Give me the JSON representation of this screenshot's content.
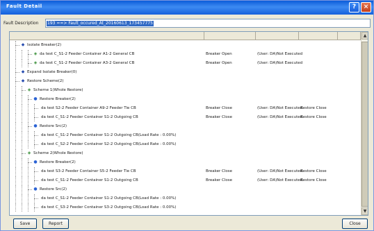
{
  "window": {
    "title": "Fault Detail",
    "help_glyph": "?",
    "close_glyph": "×"
  },
  "description": {
    "label": "Fault Description",
    "value": "193 ==> Fault_occured_At_20160613_173457775"
  },
  "scrollbar": {
    "up_glyph": "▲",
    "down_glyph": "▼"
  },
  "tree": {
    "rows": [
      {
        "name": "Isolate Breaker(2)",
        "c2": "",
        "c3": "",
        "c4": ""
      },
      {
        "name": "da test C_S1-2 Feeder Container A1-2 General CB",
        "c2": "Breaker Open",
        "c3": "(User: DA)Not Executed",
        "c4": ""
      },
      {
        "name": "da test C_S1-2 Feeder Container A3-2 General CB",
        "c2": "Breaker Open",
        "c3": "(User: DA)Not Executed",
        "c4": ""
      },
      {
        "name": "Expand Isolate Breaker(0)",
        "c2": "",
        "c3": "",
        "c4": ""
      },
      {
        "name": "Restore Scheme(2)",
        "c2": "",
        "c3": "",
        "c4": ""
      },
      {
        "name": "Scheme 1(Whole Restore)",
        "c2": "",
        "c3": "",
        "c4": ""
      },
      {
        "name": "Restore Breaker(2)",
        "c2": "",
        "c3": "",
        "c4": ""
      },
      {
        "name": "da test S2-2 Feeder Container A9-2 Feeder Tie CB",
        "c2": "Breaker Close",
        "c3": "(User: DA)Not Executed",
        "c4": "Restore Close"
      },
      {
        "name": "da test C_S1-2 Feeder Container S1-2 Outgoing CB",
        "c2": "Breaker Close",
        "c3": "(User: DA)Not Executed",
        "c4": "Restore Close"
      },
      {
        "name": "Restore Src(2)",
        "c2": "",
        "c3": "",
        "c4": ""
      },
      {
        "name": "da test C_S1-2 Feeder Container S1-2 Outgoing CB(Load Rate : 0.00%)",
        "c2": "",
        "c3": "",
        "c4": ""
      },
      {
        "name": "da test C_S2-2 Feeder Container S2-2 Outgoing CB(Load Rate : 0.00%)",
        "c2": "",
        "c3": "",
        "c4": ""
      },
      {
        "name": "Scheme 2(Whole Restore)",
        "c2": "",
        "c3": "",
        "c4": ""
      },
      {
        "name": "Restore Breaker(2)",
        "c2": "",
        "c3": "",
        "c4": ""
      },
      {
        "name": "da test S3-2 Feeder Container S5-2 Feeder Tie CB",
        "c2": "Breaker Close",
        "c3": "(User: DA)Not Executed",
        "c4": "Restore Close"
      },
      {
        "name": "da test C_S1-2 Feeder Container S1-2 Outgoing CB",
        "c2": "Breaker Close",
        "c3": "(User: DA)Not Executed",
        "c4": "Restore Close"
      },
      {
        "name": "Restore Src(2)",
        "c2": "",
        "c3": "",
        "c4": ""
      },
      {
        "name": "da test C_S1-2 Feeder Container S1-2 Outgoing CB(Load Rate : 0.00%)",
        "c2": "",
        "c3": "",
        "c4": ""
      },
      {
        "name": "da test C_S3-2 Feeder Container S3-2 Outgoing CB(Load Rate : 0.00%)",
        "c2": "",
        "c3": "",
        "c4": ""
      }
    ]
  },
  "buttons": {
    "save": "Save",
    "report": "Report",
    "close": "Close"
  }
}
